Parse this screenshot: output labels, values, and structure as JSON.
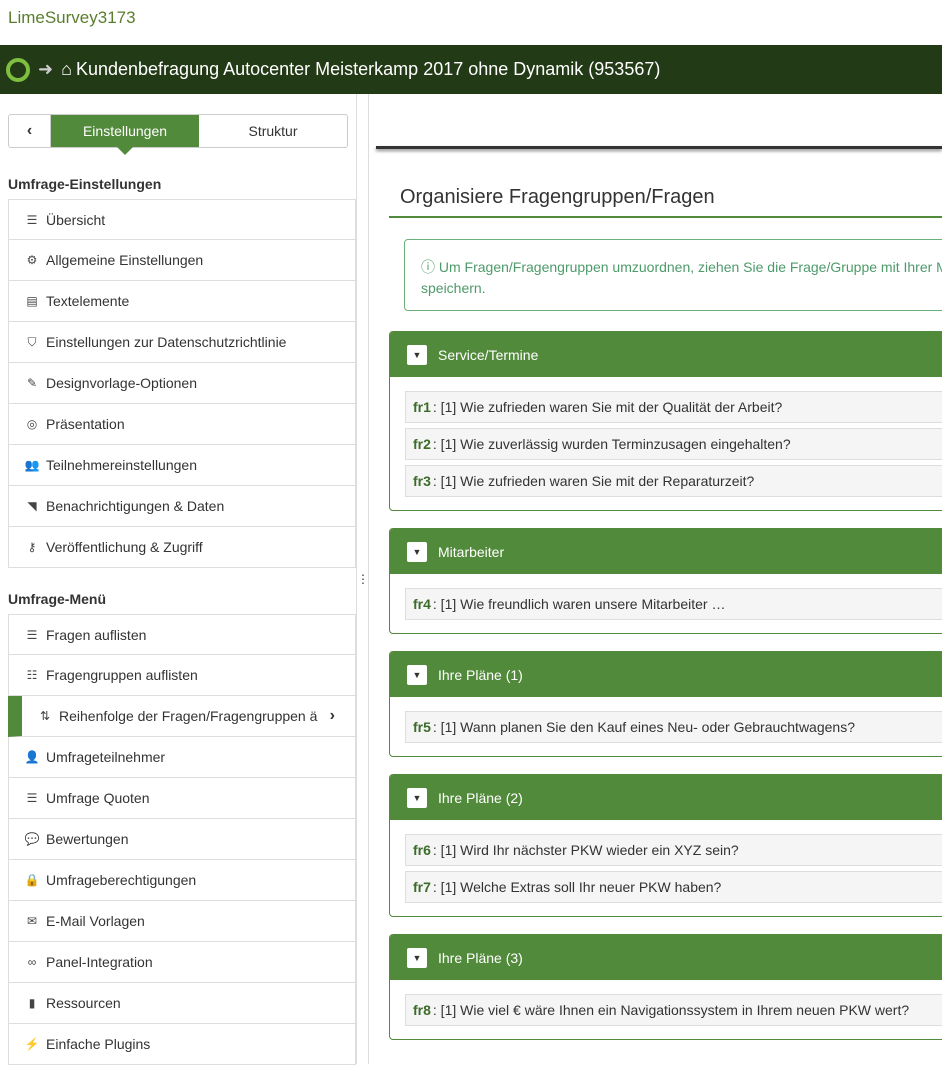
{
  "app_title": "LimeSurvey3173",
  "header": {
    "survey_title": "Kundenbefragung Autocenter Meisterkamp 2017 ohne Dynamik (953567)"
  },
  "sidebar": {
    "tabs": [
      "Einstellungen",
      "Struktur"
    ],
    "section1": "Umfrage-Einstellungen",
    "settings": [
      {
        "icon": "list-icon",
        "glyph": "☰",
        "label": "Übersicht"
      },
      {
        "icon": "gears-icon",
        "glyph": "⚙",
        "label": "Allgemeine Einstellungen"
      },
      {
        "icon": "file-text-icon",
        "glyph": "▤",
        "label": "Textelemente"
      },
      {
        "icon": "shield-icon",
        "glyph": "⛉",
        "label": "Einstellungen zur Datenschutzrichtlinie"
      },
      {
        "icon": "paintbrush-icon",
        "glyph": "✎",
        "label": "Designvorlage-Optionen"
      },
      {
        "icon": "eye-slash-icon",
        "glyph": "◎",
        "label": "Präsentation"
      },
      {
        "icon": "users-icon",
        "glyph": "👥",
        "label": "Teilnehmereinstellungen"
      },
      {
        "icon": "rss-icon",
        "glyph": "◥",
        "label": "Benachrichtigungen & Daten"
      },
      {
        "icon": "key-icon",
        "glyph": "⚷",
        "label": "Veröffentlichung & Zugriff"
      }
    ],
    "section2": "Umfrage-Menü",
    "menu": [
      {
        "icon": "list-icon",
        "glyph": "☰",
        "label": "Fragen auflisten"
      },
      {
        "icon": "th-list-icon",
        "glyph": "☷",
        "label": "Fragengruppen auflisten"
      },
      {
        "icon": "sort-icon",
        "glyph": "⇅",
        "label": "Reihenfolge der Fragen/Fragengruppen ä"
      },
      {
        "icon": "user-icon",
        "glyph": "👤",
        "label": "Umfrageteilnehmer"
      },
      {
        "icon": "tasks-icon",
        "glyph": "☰",
        "label": "Umfrage Quoten"
      },
      {
        "icon": "comment-icon",
        "glyph": "💬",
        "label": "Bewertungen"
      },
      {
        "icon": "lock-icon",
        "glyph": "🔒",
        "label": "Umfrageberechtigungen"
      },
      {
        "icon": "envelope-icon",
        "glyph": "✉",
        "label": "E-Mail Vorlagen"
      },
      {
        "icon": "link-icon",
        "glyph": "∞",
        "label": "Panel-Integration"
      },
      {
        "icon": "file-icon",
        "glyph": "▮",
        "label": "Ressourcen"
      },
      {
        "icon": "plug-icon",
        "glyph": "⚡",
        "label": "Einfache Plugins"
      }
    ]
  },
  "main": {
    "title": "Organisiere Fragengruppen/Fragen",
    "info": "Um Fragen/Fragengruppen umzuordnen, ziehen Sie die Frage/Gruppe mit Ihrer Maus an die gewünschte Position. Nach dem Umordnen bitte speichern.",
    "info_visible": "Um Fragen/Fragengruppen umzuordnen, ziehen Sie die Frage/Gruppe mit Ihrer Ma",
    "info_line2": "speichern.",
    "groups": [
      {
        "name": "Service/Termine",
        "questions": [
          {
            "code": "fr1",
            "text": ": [1] Wie zufrieden waren Sie mit der Qualität der Arbeit?"
          },
          {
            "code": "fr2",
            "text": ": [1] Wie zuverlässig wurden Terminzusagen eingehalten?"
          },
          {
            "code": "fr3",
            "text": ": [1] Wie zufrieden waren Sie mit der Reparaturzeit?"
          }
        ]
      },
      {
        "name": "Mitarbeiter",
        "questions": [
          {
            "code": "fr4",
            "text": ": [1] Wie freundlich waren unsere Mitarbeiter …"
          }
        ]
      },
      {
        "name": "Ihre Pläne (1)",
        "questions": [
          {
            "code": "fr5",
            "text": ": [1] Wann planen Sie den Kauf eines Neu- oder Gebrauchtwagens?"
          }
        ]
      },
      {
        "name": "Ihre Pläne (2)",
        "questions": [
          {
            "code": "fr6",
            "text": ": [1] Wird Ihr nächster PKW wieder ein XYZ sein?"
          },
          {
            "code": "fr7",
            "text": ": [1] Welche Extras soll Ihr neuer PKW haben?"
          }
        ]
      },
      {
        "name": "Ihre Pläne (3)",
        "questions": [
          {
            "code": "fr8",
            "text": ": [1] Wie viel € wäre Ihnen ein Navigationssystem in Ihrem neuen PKW wert?"
          }
        ]
      }
    ]
  }
}
